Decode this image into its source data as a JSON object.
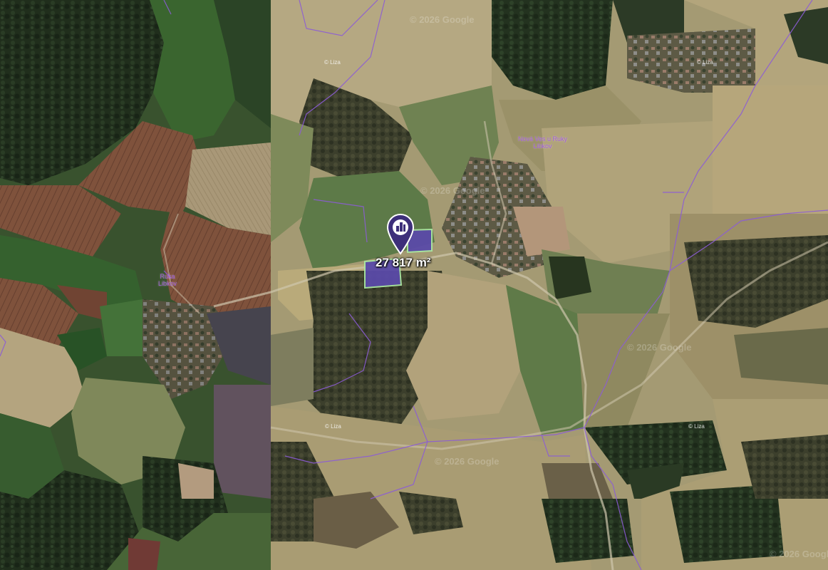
{
  "map": {
    "view": "satellite",
    "parcel_area_label": "27 817 m²",
    "accent_color": "#3d2f7a",
    "parcel_fill_color": "#5a4aa8",
    "parcel_outline_color": "#a9e6a0",
    "boundary_color": "#8c5cd6",
    "watermarks": [
      "© 2026 Google",
      "© 2026 Google",
      "© 2026 Google",
      "© 2026 Google",
      "© 2026 Google"
    ],
    "poi_labels": [
      "© Liza",
      "© Liza",
      "© Liza",
      "© Liza"
    ],
    "place_labels": [
      {
        "line1": "Nová Ves u Ruky",
        "line2": "Libkov"
      },
      {
        "line1": "Ruka",
        "line2": "Libkov"
      }
    ],
    "icons": {
      "pin": "map-pin-icon",
      "building": "building-icon"
    }
  }
}
